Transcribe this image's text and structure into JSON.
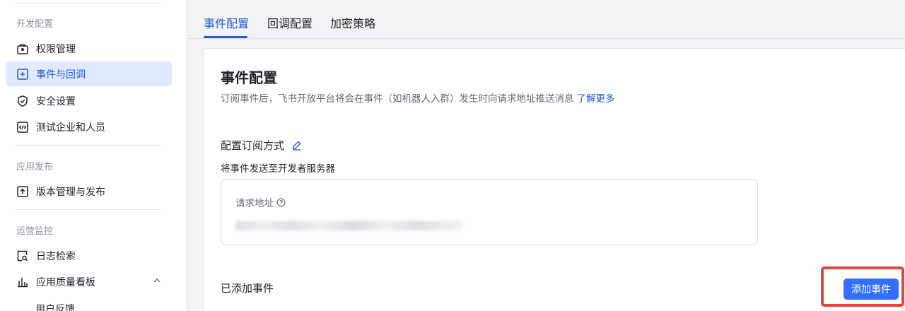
{
  "sidebar": {
    "sections": [
      "开发配置",
      "应用发布",
      "运营监控"
    ],
    "items": [
      {
        "label": "权限管理",
        "icon": "lock-box-icon"
      },
      {
        "label": "事件与回调",
        "icon": "plus-box-icon",
        "active": true
      },
      {
        "label": "安全设置",
        "icon": "shield-check-icon"
      },
      {
        "label": "测试企业和人员",
        "icon": "code-box-icon"
      },
      {
        "label": "版本管理与发布",
        "icon": "upload-box-icon"
      },
      {
        "label": "日志检索",
        "icon": "search-doc-icon"
      },
      {
        "label": "应用质量看板",
        "icon": "bar-chart-icon"
      }
    ],
    "sub_items": [
      "用户反馈"
    ]
  },
  "tabs": [
    {
      "label": "事件配置",
      "active": true
    },
    {
      "label": "回调配置"
    },
    {
      "label": "加密策略"
    }
  ],
  "card": {
    "title": "事件配置",
    "description": "订阅事件后，飞书开放平台将会在事件（如机器人入群）发生时向请求地址推送消息",
    "learn_more": "了解更多",
    "subscribe_heading": "配置订阅方式",
    "subscribe_text": "将事件发送至开发者服务器",
    "url_label": "请求地址",
    "added_heading": "已添加事件",
    "add_button": "添加事件"
  },
  "colors": {
    "accent": "#245bdb",
    "button": "#3370ff",
    "active_bg": "#e1eaff",
    "highlight": "#e8433f"
  }
}
